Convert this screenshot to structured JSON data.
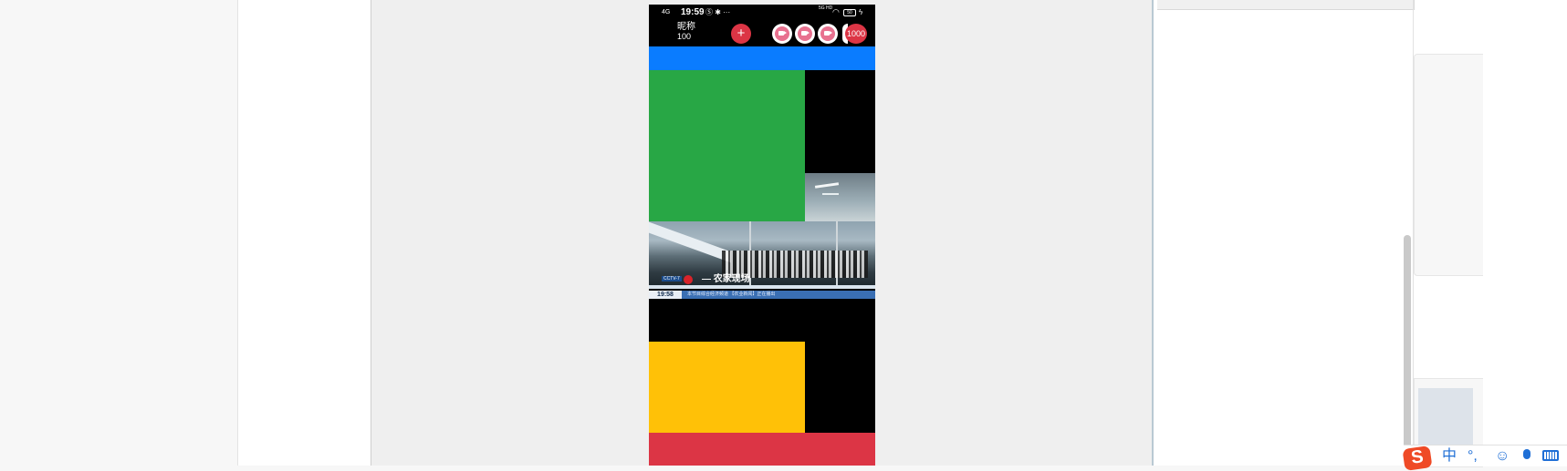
{
  "status_bar": {
    "signal": "4G",
    "time": "19:59",
    "left_icons": "Ⓢ ✱ ···",
    "network": "5G HD",
    "wifi_icon": "wifi-icon",
    "battery": "50",
    "bolt": "ϟ"
  },
  "room": {
    "nickname": "昵称",
    "nickname_value": "100",
    "add_label": "+",
    "count": "1000",
    "camera_icons": [
      "camera-icon",
      "camera-icon",
      "camera-icon"
    ]
  },
  "video": {
    "logo": "CCTV-7",
    "title": "— 农家现场",
    "ticker_time": "19:58",
    "ticker_text": "本节目综合经济频道 【农业新闻】正在播出"
  },
  "colors": {
    "blue": "#0a7cff",
    "green": "#28a745",
    "yellow": "#ffc107",
    "red": "#dc3545"
  },
  "ime": {
    "logo": "S",
    "mode": "中",
    "punct": "°,",
    "emoji": "☺"
  }
}
